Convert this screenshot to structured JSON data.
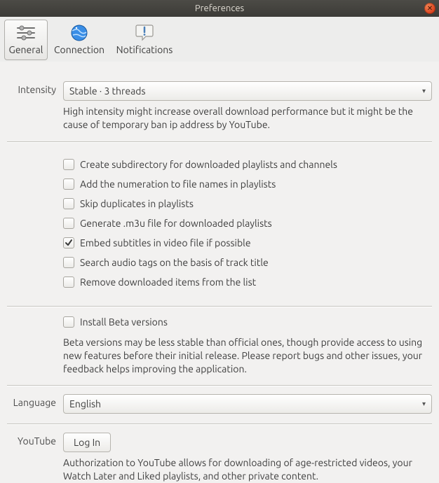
{
  "window": {
    "title": "Preferences"
  },
  "tabs": {
    "general": "General",
    "connection": "Connection",
    "notifications": "Notifications"
  },
  "intensity": {
    "label": "Intensity",
    "value": "Stable · 3 threads",
    "help": "High intensity might increase overall download performance but it might be the cause of temporary ban ip address by YouTube."
  },
  "opts": {
    "subdir": "Create subdirectory for downloaded playlists and channels",
    "numeration": "Add the numeration to file names in playlists",
    "skipdup": "Skip duplicates in playlists",
    "m3u": "Generate .m3u file for downloaded playlists",
    "embed": "Embed subtitles in video file if possible",
    "tags": "Search audio tags on the basis of track title",
    "remove": "Remove downloaded items from the list"
  },
  "beta": {
    "label": "Install Beta versions",
    "help": "Beta versions may be less stable than official ones, though provide access to using new features before their initial release. Please report bugs and other issues, your feedback helps improving the application."
  },
  "language": {
    "label": "Language",
    "value": "English"
  },
  "youtube": {
    "label": "YouTube",
    "button": "Log In",
    "help": "Authorization to YouTube allows for downloading of age-restricted videos, your Watch Later and Liked playlists, and other private content."
  }
}
